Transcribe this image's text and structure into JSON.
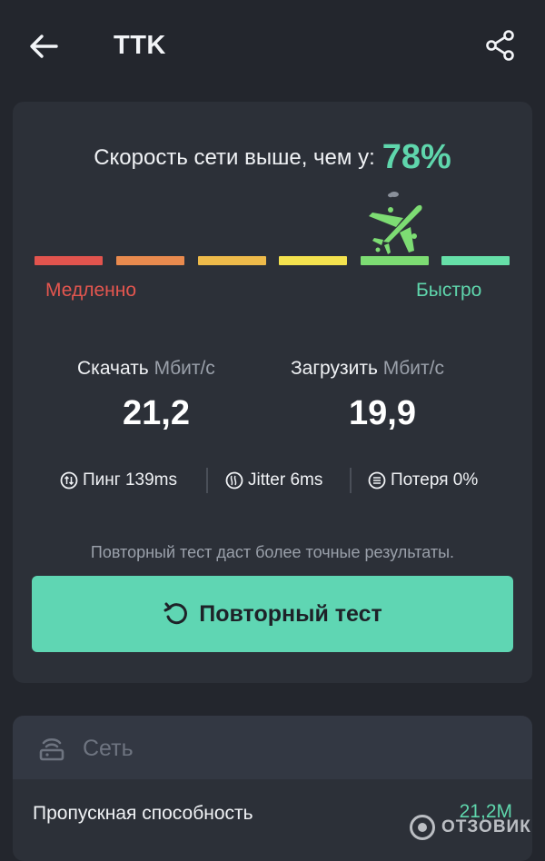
{
  "header": {
    "title": "TTK"
  },
  "speed": {
    "headline": "Скорость сети выше, чем у:",
    "percent": "78%",
    "percent_value": 78
  },
  "scale": {
    "segments": [
      "#e2544e",
      "#e98a4e",
      "#eeba4a",
      "#f4e24e",
      "#7ddc73",
      "#66dfa8"
    ],
    "active_segment_index": 4,
    "slow_label": "Медленно",
    "fast_label": "Быстро"
  },
  "download": {
    "label": "Скачать",
    "unit": "Мбит/с",
    "value": "21,2"
  },
  "upload": {
    "label": "Загрузить",
    "unit": "Мбит/с",
    "value": "19,9"
  },
  "stats": {
    "ping": "Пинг 139ms",
    "jitter": "Jitter 6ms",
    "loss": "Потеря 0%"
  },
  "hint": "Повторный тест даст более точные результаты.",
  "retest_label": "Повторный тест",
  "network": {
    "title": "Сеть",
    "rows": [
      {
        "label": "Пропускная способность",
        "value": "21,2M"
      }
    ]
  },
  "watermark": "ОТЗОВИК",
  "colors": {
    "accent": "#5fd6ac",
    "background": "#23262d",
    "card": "#2c3038"
  },
  "icons": [
    "back-arrow-icon",
    "share-icon",
    "plane-icon",
    "ping-icon",
    "jitter-icon",
    "loss-icon",
    "refresh-icon",
    "router-icon"
  ]
}
